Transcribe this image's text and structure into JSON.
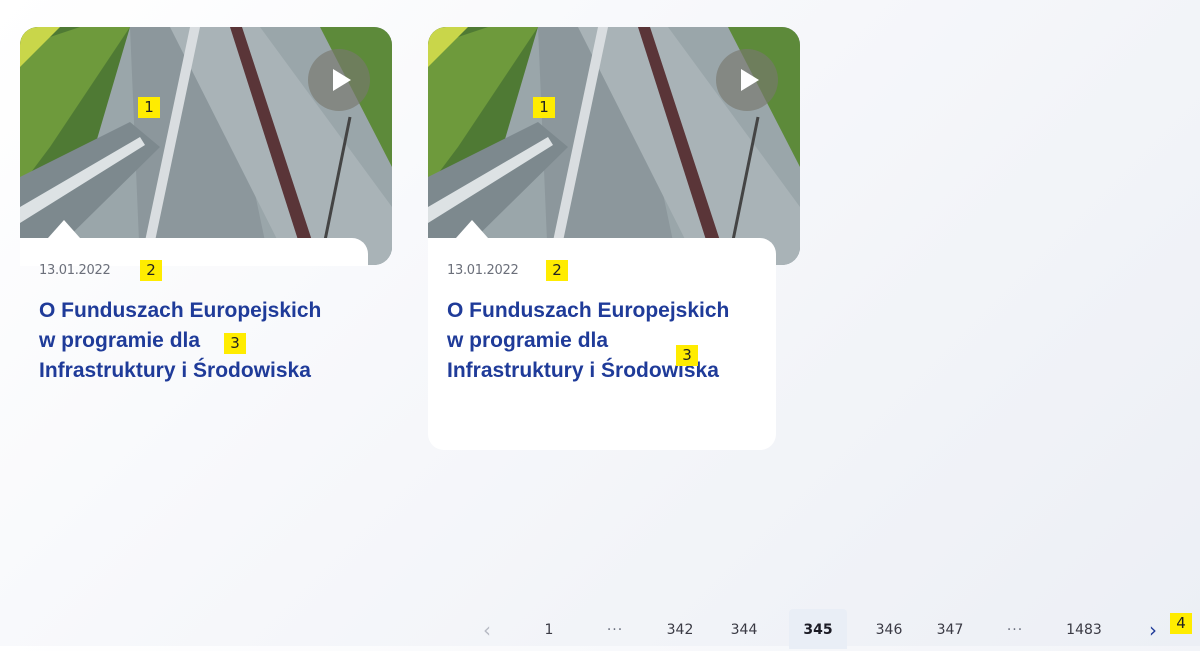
{
  "cards": [
    {
      "date": "13.01.2022",
      "title": "O Funduszach Europejskich w programie dla Infrastruktury i Środowiska",
      "markers": {
        "image": "1",
        "date": "2",
        "title": "3"
      }
    },
    {
      "date": "13.01.2022",
      "title": "O Funduszach Europejskich w programie dla Infrastruktury i Środowiska",
      "markers": {
        "image": "1",
        "date": "2",
        "title": "3"
      }
    }
  ],
  "pagination": {
    "prev_icon": "chevron-left-icon",
    "next_icon": "chevron-right-icon",
    "prev": "‹",
    "next": "›",
    "pages": [
      "1",
      "···",
      "342",
      "344",
      "345",
      "346",
      "347",
      "···",
      "1483"
    ],
    "current": "345",
    "marker": "4"
  },
  "colors": {
    "title": "#1f3b99",
    "marker": "#ffec00",
    "current_page_bg": "#e9eef6"
  }
}
